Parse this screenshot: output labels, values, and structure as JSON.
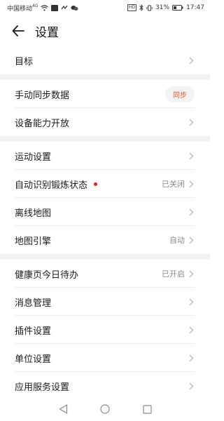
{
  "status_bar": {
    "carrier": "中国移动",
    "carrier_sup": "4G",
    "battery": "31%",
    "time": "17:47",
    "hd_label": "HD"
  },
  "header": {
    "title": "设置",
    "back_icon": "back-arrow-icon"
  },
  "sections": [
    {
      "rows": [
        {
          "label": "目标",
          "value": "",
          "type": "chevron"
        }
      ]
    },
    {
      "rows": [
        {
          "label": "手动同步数据",
          "value": "同步",
          "type": "pill"
        },
        {
          "label": "设备能力开放",
          "value": "",
          "type": "chevron"
        }
      ]
    },
    {
      "rows": [
        {
          "label": "运动设置",
          "value": "",
          "type": "chevron"
        },
        {
          "label": "自动识别锻炼状态",
          "value": "已关闭",
          "type": "chevron",
          "red_dot": true
        },
        {
          "label": "离线地图",
          "value": "",
          "type": "chevron"
        },
        {
          "label": "地图引擎",
          "value": "自动",
          "type": "chevron"
        }
      ]
    },
    {
      "rows": [
        {
          "label": "健康页今日待办",
          "value": "已开启",
          "type": "chevron"
        },
        {
          "label": "消息管理",
          "value": "",
          "type": "chevron"
        },
        {
          "label": "插件设置",
          "value": "",
          "type": "chevron"
        },
        {
          "label": "单位设置",
          "value": "",
          "type": "chevron"
        },
        {
          "label": "应用服务设置",
          "value": "",
          "type": "chevron"
        }
      ]
    }
  ],
  "colors": {
    "accent": "#e8532a",
    "divider": "#f2f2f2",
    "red_dot": "#e02020"
  }
}
